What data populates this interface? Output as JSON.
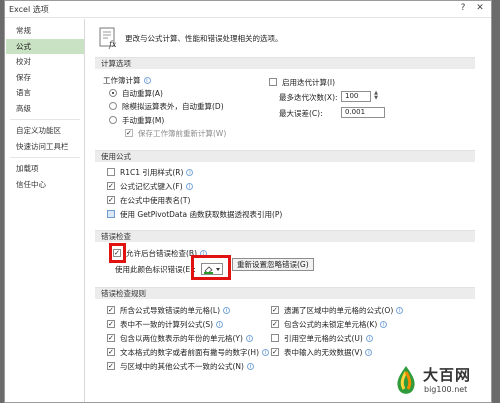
{
  "window": {
    "title": "Excel 选项",
    "help": "?",
    "close": "✕"
  },
  "sidebar": {
    "items": [
      {
        "label": "常规",
        "active": false
      },
      {
        "label": "公式",
        "active": true
      },
      {
        "label": "校对",
        "active": false
      },
      {
        "label": "保存",
        "active": false
      },
      {
        "label": "语言",
        "active": false
      },
      {
        "label": "高级",
        "active": false
      },
      {
        "label": "自定义功能区",
        "active": false
      },
      {
        "label": "快速访问工具栏",
        "active": false
      },
      {
        "label": "加载项",
        "active": false
      },
      {
        "label": "信任中心",
        "active": false
      }
    ]
  },
  "header": {
    "text": "更改与公式计算、性能和错误处理相关的选项。"
  },
  "calc": {
    "section": "计算选项",
    "workbook_label": "工作簿计算",
    "auto": "自动重算(A)",
    "auto_except": "除模拟运算表外，自动重算(D)",
    "manual": "手动重算(M)",
    "recalc_before_save": "保存工作簿前重新计算(W)",
    "iterative": "启用迭代计算(I)",
    "max_iter_label": "最多迭代次数(X):",
    "max_iter_value": "100",
    "max_change_label": "最大误差(C):",
    "max_change_value": "0.001"
  },
  "formulas": {
    "section": "使用公式",
    "r1c1": "R1C1 引用样式(R)",
    "autocomplete": "公式记忆式键入(F)",
    "table_names": "在公式中使用表名(T)",
    "getpivot": "使用 GetPivotData 函数获取数据透视表引用(P)"
  },
  "errcheck": {
    "section": "错误检查",
    "enable_bg": "允许后台错误检查(B)",
    "color_label": "使用此颜色标识错误(E):",
    "reset_button": "重新设置忽略错误(G)"
  },
  "rules": {
    "section": "错误检查规则",
    "left": [
      {
        "label": "所含公式导致错误的单元格(L)",
        "checked": true
      },
      {
        "label": "表中不一致的计算列公式(S)",
        "checked": true
      },
      {
        "label": "包含以两位数表示的年份的单元格(Y)",
        "checked": true
      },
      {
        "label": "文本格式的数字或者前面有撇号的数字(H)",
        "checked": true
      },
      {
        "label": "与区域中的其他公式不一致的公式(N)",
        "checked": true
      }
    ],
    "right": [
      {
        "label": "遗漏了区域中的单元格的公式(O)",
        "checked": true
      },
      {
        "label": "包含公式的未锁定单元格(K)",
        "checked": true
      },
      {
        "label": "引用空单元格的公式(U)",
        "checked": false
      },
      {
        "label": "表中输入的无效数据(V)",
        "checked": true
      }
    ]
  },
  "watermark": {
    "big": "大百网",
    "small": "big100.net"
  },
  "colors": {
    "accent": "#c9e2c3",
    "highlight": "#e11212"
  }
}
